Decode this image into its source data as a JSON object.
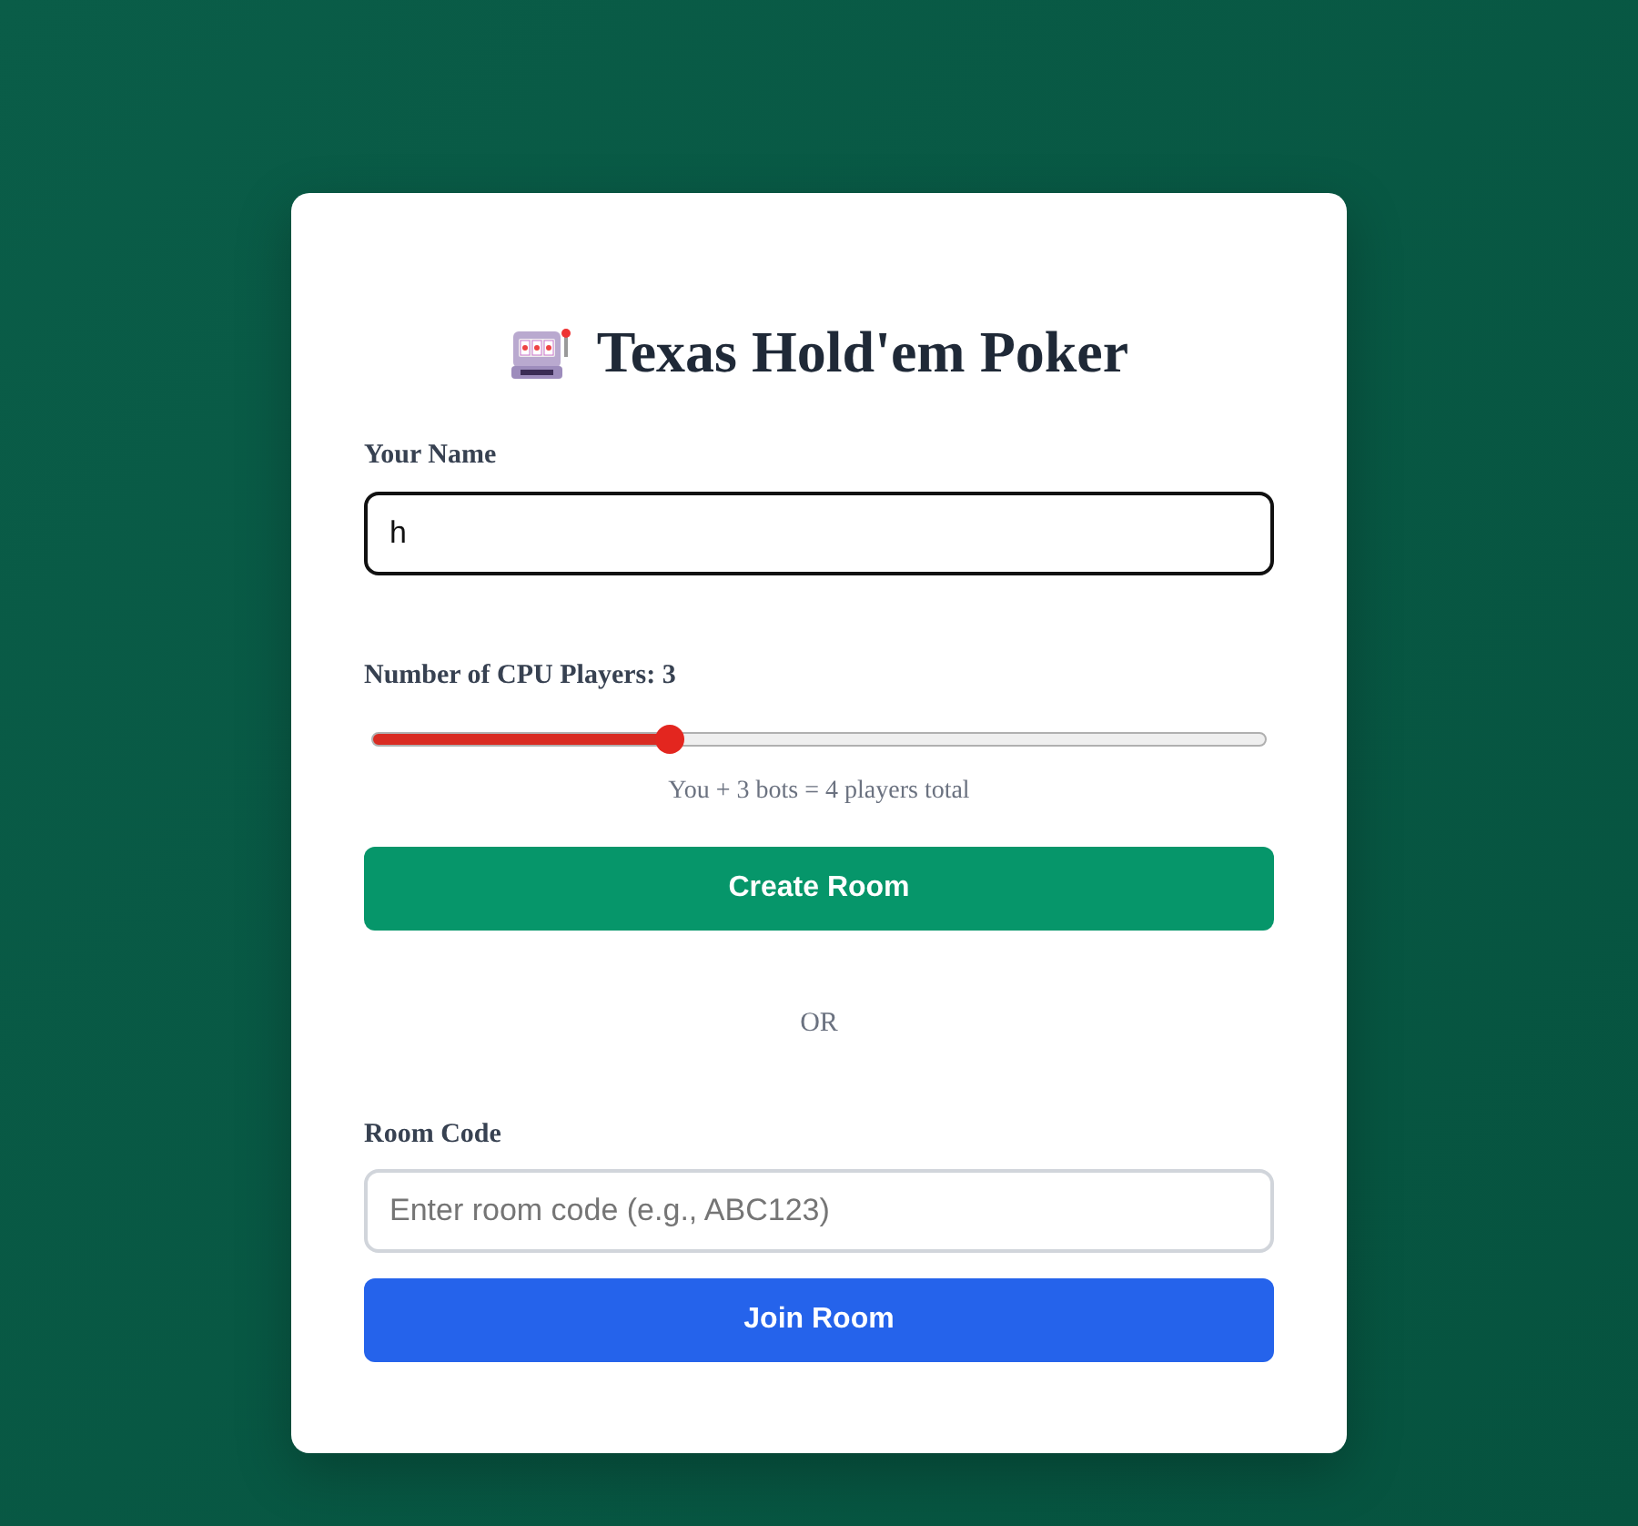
{
  "title": "Texas Hold'em Poker",
  "name_field": {
    "label": "Your Name",
    "value": "h"
  },
  "cpu_players": {
    "label": "Number of CPU Players: 3",
    "level": 0.333,
    "summary": "You + 3 bots = 4 players total"
  },
  "create_button": "Create Room",
  "divider": "OR",
  "room_code": {
    "label": "Room Code",
    "placeholder": "Enter room code (e.g., ABC123)"
  },
  "join_button": "Join Room"
}
